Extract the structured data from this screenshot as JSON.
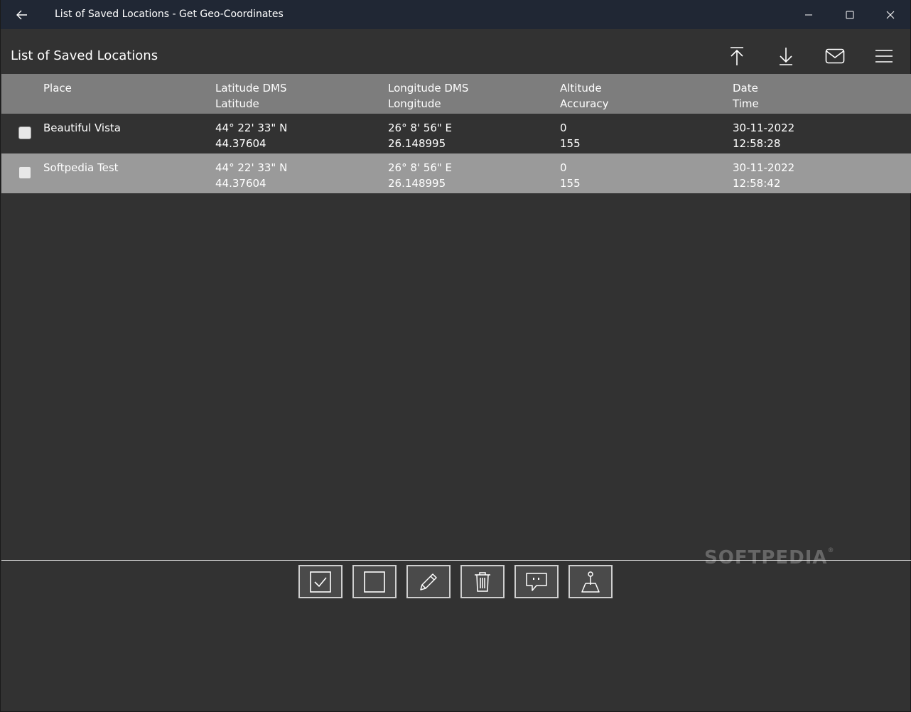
{
  "window": {
    "title": "List of Saved Locations - Get Geo-Coordinates"
  },
  "page": {
    "title": "List of Saved Locations"
  },
  "toolbar": {
    "icons": [
      "upload-icon",
      "download-icon",
      "mail-icon",
      "hamburger-menu-icon"
    ]
  },
  "table": {
    "headers": {
      "place": "Place",
      "lat_dms": "Latitude DMS",
      "lat": "Latitude",
      "lon_dms": "Longitude DMS",
      "lon": "Longitude",
      "altitude": "Altitude",
      "accuracy": "Accuracy",
      "date": "Date",
      "time": "Time"
    },
    "rows": [
      {
        "place": "Beautiful Vista",
        "lat_dms": "44° 22' 33\" N",
        "lat": "44.37604",
        "lon_dms": "26° 8' 56\" E",
        "lon": "26.148995",
        "altitude": "0",
        "accuracy": "155",
        "date": "30-11-2022",
        "time": "12:58:28"
      },
      {
        "place": "Softpedia Test",
        "lat_dms": "44° 22' 33\" N",
        "lat": "44.37604",
        "lon_dms": "26° 8' 56\" E",
        "lon": "26.148995",
        "altitude": "0",
        "accuracy": "155",
        "date": "30-11-2022",
        "time": "12:58:42"
      }
    ]
  },
  "bottom_bar": {
    "icons": [
      "select-all-icon",
      "deselect-all-icon",
      "edit-icon",
      "delete-icon",
      "comment-icon",
      "map-pin-icon"
    ]
  },
  "watermark": {
    "text": "SOFTPEDIA",
    "mark": "®"
  },
  "colors": {
    "titlebar": "#202734",
    "background": "#323232",
    "header_row": "#7d7d7d",
    "selected_row": "#9a9a9a"
  }
}
